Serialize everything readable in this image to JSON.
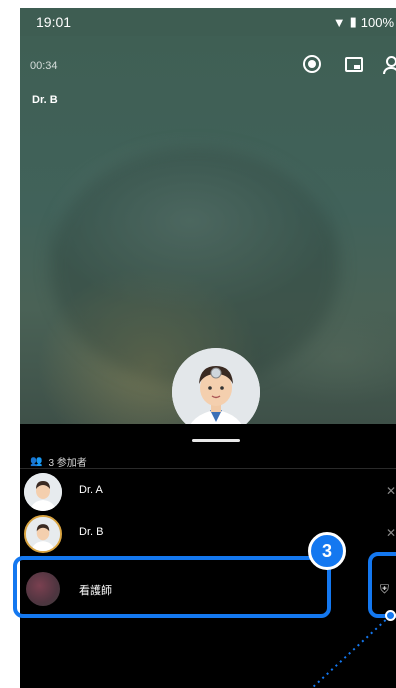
{
  "status_bar": {
    "time": "19:01",
    "battery": "100%"
  },
  "call": {
    "duration": "00:34",
    "active_speaker": "Dr. B"
  },
  "participants_panel": {
    "count_label": "3 参加者",
    "participants": [
      {
        "name": "Dr. A",
        "avatar": "doctor-avatar"
      },
      {
        "name": "Dr. B",
        "avatar": "doctor-avatar"
      },
      {
        "name": "看護師",
        "avatar": "photo-avatar"
      }
    ]
  },
  "annotation": {
    "step_number": "3",
    "highlight_color": "#1478f0"
  },
  "colors": {
    "video_bg": "#41625a",
    "sheet_bg": "#000000",
    "accent": "#1478f0"
  },
  "icons": [
    "record-icon",
    "picture-in-picture-icon",
    "person-icon",
    "people-icon",
    "mic-icon",
    "shield-icon"
  ]
}
